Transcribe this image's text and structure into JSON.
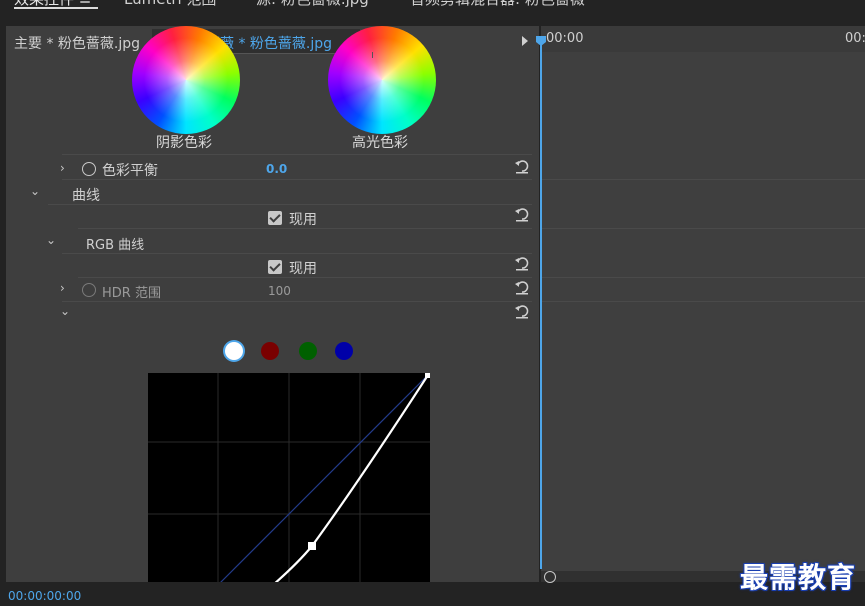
{
  "colors": {
    "accent": "#4ea6ea",
    "panel_bg": "#3e3e3e",
    "app_bg": "#232323"
  },
  "source": {
    "main_clip": "主要 * 粉色蔷薇.jpg",
    "selected_clip": "粉色蔷薇 * 粉色蔷薇.jpg"
  },
  "wheels": {
    "shadow_label": "阴影色彩",
    "highlight_label": "高光色彩"
  },
  "rows": {
    "color_balance": {
      "label": "色彩平衡",
      "value": "0.0"
    },
    "curves_label": "曲线",
    "apply_1": "现用",
    "rgb_curve_label": "RGB 曲线",
    "apply_2": "现用",
    "hdr": {
      "label": "HDR 范围",
      "value": "100"
    }
  },
  "channels": [
    "white",
    "red",
    "green",
    "blue"
  ],
  "timeline": {
    "start_time": "00:00",
    "end_time": "00:",
    "current_timecode": "00:00:00:00"
  },
  "watermark": "最需教育"
}
